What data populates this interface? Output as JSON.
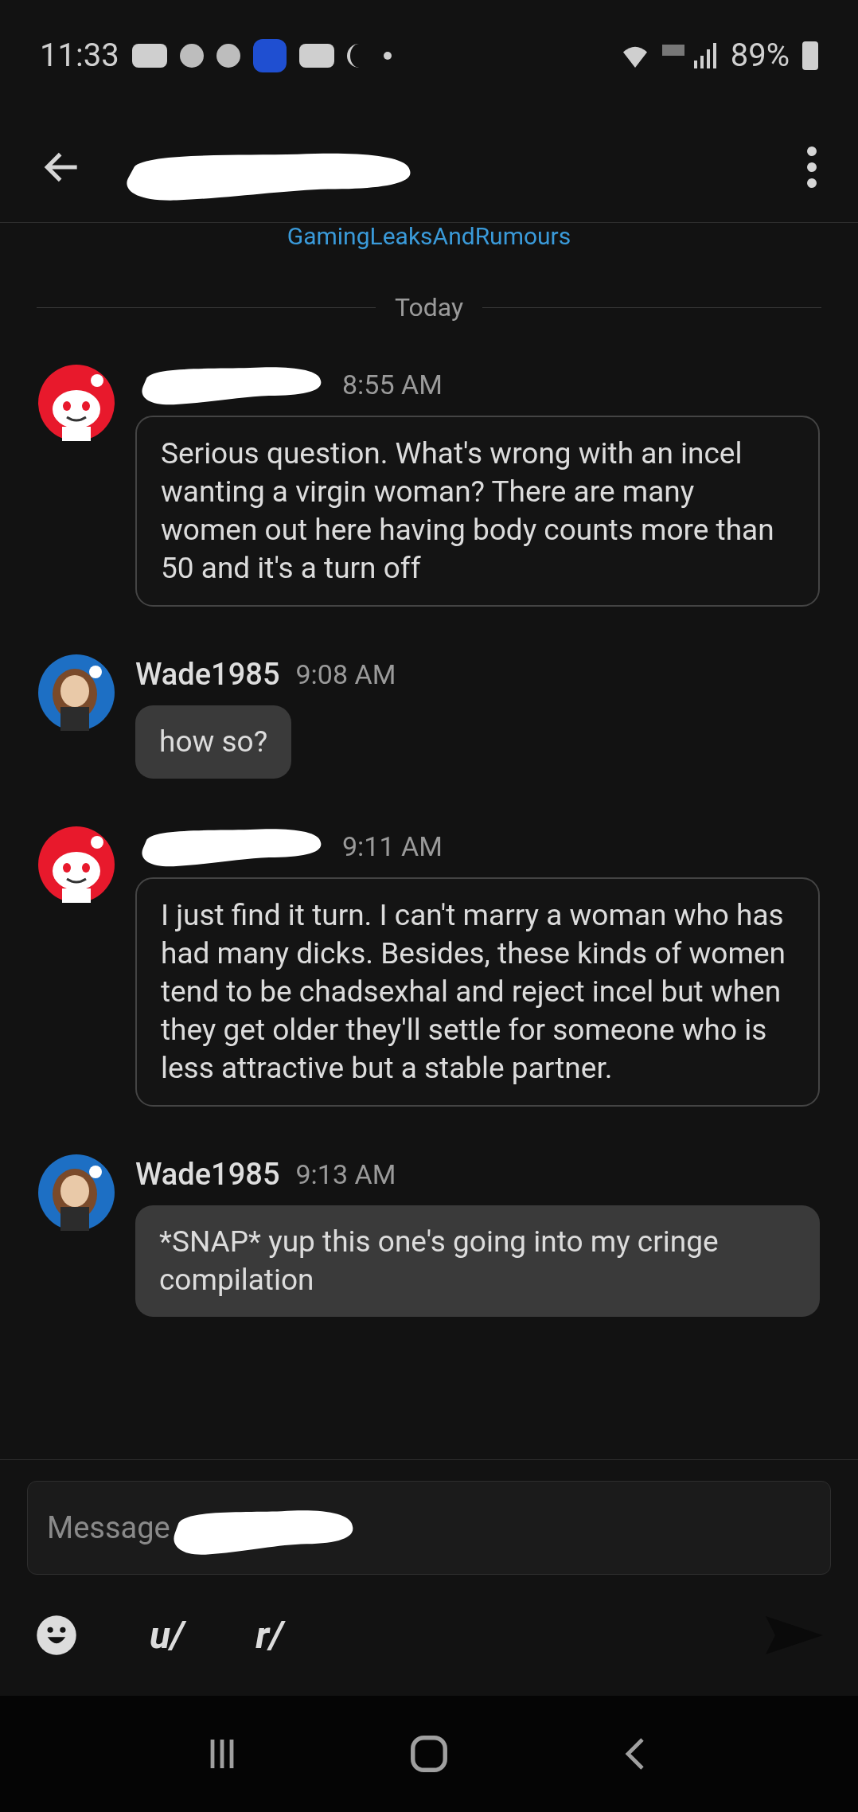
{
  "status_bar": {
    "time": "11:33",
    "battery": "89%"
  },
  "header": {
    "subtitle": "GamingLeaksAndRumours"
  },
  "divider": {
    "label": "Today"
  },
  "messages": [
    {
      "kind": "other",
      "time": "8:55 AM",
      "text": "Serious question. What's wrong with an incel wanting a virgin woman? There are many women out here having body counts more than 50 and it's a turn off"
    },
    {
      "kind": "self",
      "author": "Wade1985",
      "time": "9:08 AM",
      "text": "how so?"
    },
    {
      "kind": "other",
      "time": "9:11 AM",
      "text": "I just find it turn. I can't marry a woman who has had many dicks. Besides, these kinds of women tend to be chadsexhal and reject incel but when they get older they'll settle for someone who is less attractive but a stable partner."
    },
    {
      "kind": "self",
      "author": "Wade1985",
      "time": "9:13 AM",
      "text": "*SNAP* yup this one's going into my cringe compilation"
    }
  ],
  "composer": {
    "placeholder": "Message",
    "tools": [
      "u/",
      "r/"
    ]
  }
}
